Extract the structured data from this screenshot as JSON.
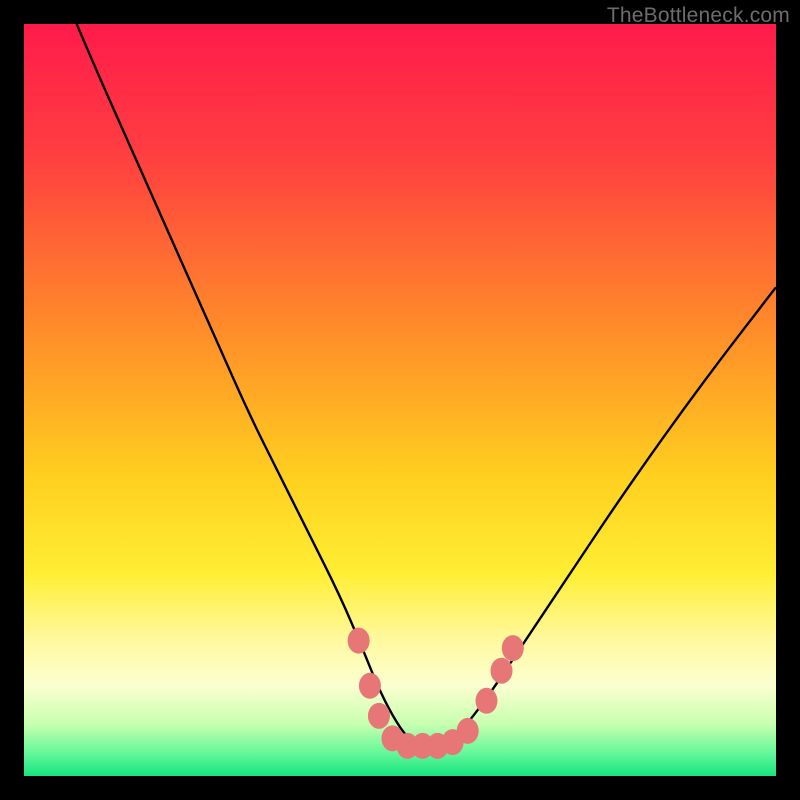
{
  "watermark": "TheBottleneck.com",
  "chart_data": {
    "type": "line",
    "title": "",
    "xlabel": "",
    "ylabel": "",
    "xlim": [
      0,
      100
    ],
    "ylim": [
      0,
      100
    ],
    "grid": false,
    "legend": false,
    "gradient_stops": [
      {
        "offset": 0,
        "color": "#ff1b4b"
      },
      {
        "offset": 0.18,
        "color": "#ff4040"
      },
      {
        "offset": 0.4,
        "color": "#ff8a2a"
      },
      {
        "offset": 0.6,
        "color": "#ffcf1f"
      },
      {
        "offset": 0.73,
        "color": "#ffee33"
      },
      {
        "offset": 0.82,
        "color": "#fff9a0"
      },
      {
        "offset": 0.88,
        "color": "#fbffd0"
      },
      {
        "offset": 0.93,
        "color": "#c9ffb0"
      },
      {
        "offset": 0.97,
        "color": "#63f79a"
      },
      {
        "offset": 1.0,
        "color": "#17e47e"
      }
    ],
    "curve": {
      "name": "bottleneck-curve",
      "x": [
        7,
        10,
        14,
        18,
        22,
        26,
        30,
        34,
        38,
        42,
        45,
        47,
        49,
        51,
        53,
        55,
        57,
        59,
        62,
        66,
        72,
        80,
        90,
        100
      ],
      "y": [
        100,
        93,
        84,
        75,
        66,
        57,
        48,
        40,
        32,
        24,
        17,
        12,
        8,
        5,
        4,
        4,
        5,
        7,
        11,
        17,
        26,
        38,
        52,
        65
      ]
    },
    "valley_markers": {
      "color": "#e77777",
      "points": [
        {
          "x": 44.5,
          "y": 18
        },
        {
          "x": 46.0,
          "y": 12
        },
        {
          "x": 47.2,
          "y": 8
        },
        {
          "x": 49.0,
          "y": 5
        },
        {
          "x": 51.0,
          "y": 4
        },
        {
          "x": 53.0,
          "y": 4
        },
        {
          "x": 55.0,
          "y": 4
        },
        {
          "x": 57.0,
          "y": 4.5
        },
        {
          "x": 59.0,
          "y": 6
        },
        {
          "x": 61.5,
          "y": 10
        },
        {
          "x": 63.5,
          "y": 14
        },
        {
          "x": 65.0,
          "y": 17
        }
      ]
    }
  }
}
